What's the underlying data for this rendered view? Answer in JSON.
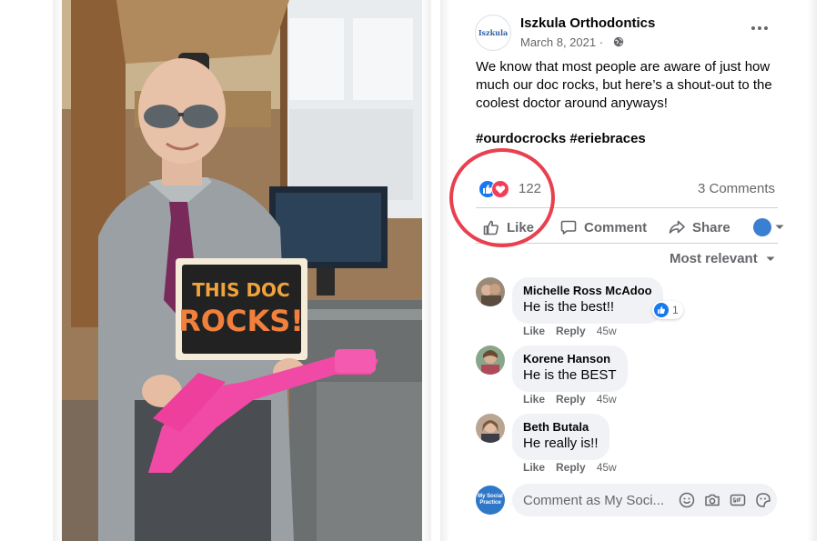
{
  "post": {
    "page_name": "Iszkula Orthodontics",
    "page_logo_text": "Iszkula",
    "date": "March 8, 2021 ·",
    "text": "We know that most people are aware of just how much our doc rocks, but here’s a shout-out to the coolest doctor around anyways!",
    "hashtags": "#ourdocrocks #eriebraces",
    "reaction_count": "122",
    "comments_count": "3 Comments",
    "reactions": [
      "like-icon",
      "love-icon"
    ],
    "annotation_color": "#e8404e"
  },
  "photo": {
    "sign_line1": "THIS DOC",
    "sign_line2": "ROCKS!"
  },
  "actions": {
    "like": "Like",
    "comment": "Comment",
    "share": "Share"
  },
  "sort_label": "Most relevant",
  "comments": [
    {
      "name": "Michelle Ross McAdoo",
      "text": "He is the best!!",
      "like": "Like",
      "reply": "Reply",
      "time": "45w",
      "reaction_count": "1"
    },
    {
      "name": "Korene Hanson",
      "text": "He is the BEST",
      "like": "Like",
      "reply": "Reply",
      "time": "45w"
    },
    {
      "name": "Beth Butala",
      "text": "He really is!!",
      "like": "Like",
      "reply": "Reply",
      "time": "45w"
    }
  ],
  "composer": {
    "placeholder": "Comment as My Soci...",
    "avatar_text": "My Social Practice"
  },
  "colors": {
    "facebook_blue": "#1877f2",
    "love_red": "#f33e58",
    "secondary_text": "#65676b",
    "sign_pink": "#f04aa6"
  }
}
